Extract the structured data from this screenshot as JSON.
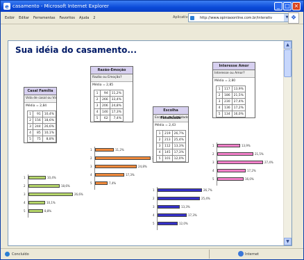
{
  "window": {
    "title": "casamento - Microsoft Internet Explorer",
    "minimize": "_",
    "maximize": "□",
    "close": "×"
  },
  "menu": [
    "Exibir",
    "Editar",
    "Ferramentas",
    "Favoritos",
    "Ajuda",
    "2"
  ],
  "address": {
    "go_label": "Aplicativo",
    "url": "http://www.opiniaoonline.com.br/interativ"
  },
  "page": {
    "title": "Sua idéia do casamento..."
  },
  "status": {
    "left": "Concluído",
    "right": "Internet"
  },
  "colors": {
    "titlebar": "#0a4ad8",
    "poll_head": "#d7d0f0",
    "green": "#b5d66a",
    "orange": "#f08a3c",
    "blue": "#3530c8",
    "pink": "#f27fc9"
  },
  "polls": [
    {
      "name": "poll-fidelity",
      "header": "Casal Família",
      "question": "Vida de casal ou Vida de família?",
      "avg": "Média = 2,84",
      "rows": [
        {
          "n": "1",
          "count": "91",
          "pct": "10,4%"
        },
        {
          "n": "2",
          "count": "156",
          "pct": "18,6%"
        },
        {
          "n": "3",
          "count": "244",
          "pct": "26,6%"
        },
        {
          "n": "4",
          "count": "85",
          "pct": "10,1%"
        },
        {
          "n": "5",
          "count": "75",
          "pct": "8,8%"
        }
      ],
      "bar_labels": [
        "10,4%",
        "18,6%",
        "26,6%",
        "10,1%",
        "8,8%"
      ],
      "bar_values": [
        10.4,
        18.6,
        26.6,
        10.1,
        8.8
      ],
      "color": "#b5d66a"
    },
    {
      "name": "poll-reason",
      "header": "Razão-Emoção",
      "question": "Razão ou Emoção?",
      "avg": "Média = 2,85",
      "rows": [
        {
          "n": "1",
          "count": "94",
          "pct": "11,2%"
        },
        {
          "n": "2",
          "count": "266",
          "pct": "33,4%"
        },
        {
          "n": "3",
          "count": "206",
          "pct": "24,8%"
        },
        {
          "n": "4",
          "count": "146",
          "pct": "17,3%"
        },
        {
          "n": "5",
          "count": "62",
          "pct": "7,4%"
        }
      ],
      "bar_labels": [
        "11,2%",
        "33,4%",
        "24,8%",
        "17,3%",
        "7,4%"
      ],
      "bar_values": [
        11.2,
        33.4,
        24.8,
        17.3,
        7.4
      ],
      "color": "#f08a3c"
    },
    {
      "name": "poll-freedom",
      "header": "Escolha Fatalidade",
      "question": "Escolha ou Fatalidade?",
      "avg": "Média = 2,43",
      "rows": [
        {
          "n": "1",
          "count": "219",
          "pct": "26,7%"
        },
        {
          "n": "2",
          "count": "213",
          "pct": "25,4%"
        },
        {
          "n": "3",
          "count": "112",
          "pct": "13,3%"
        },
        {
          "n": "4",
          "count": "145",
          "pct": "17,3%"
        },
        {
          "n": "5",
          "count": "101",
          "pct": "12,0%"
        }
      ],
      "bar_labels": [
        "26,7%",
        "25,4%",
        "13,3%",
        "17,3%",
        "12,0%"
      ],
      "bar_values": [
        26.7,
        25.4,
        13.3,
        17.3,
        12.0
      ],
      "color": "#3530c8"
    },
    {
      "name": "poll-interest",
      "header": "Interesse Amor",
      "question": "Interesse ou Amor?",
      "avg": "Média = 2,80",
      "rows": [
        {
          "n": "1",
          "count": "117",
          "pct": "13,9%"
        },
        {
          "n": "2",
          "count": "186",
          "pct": "21,5%"
        },
        {
          "n": "3",
          "count": "230",
          "pct": "27,4%"
        },
        {
          "n": "4",
          "count": "136",
          "pct": "17,2%"
        },
        {
          "n": "5",
          "count": "134",
          "pct": "16,0%"
        }
      ],
      "bar_labels": [
        "13,9%",
        "21,5%",
        "27,4%",
        "17,2%",
        "16,0%"
      ],
      "bar_values": [
        13.9,
        21.5,
        27.4,
        17.2,
        16.0
      ],
      "color": "#f27fc9"
    }
  ]
}
